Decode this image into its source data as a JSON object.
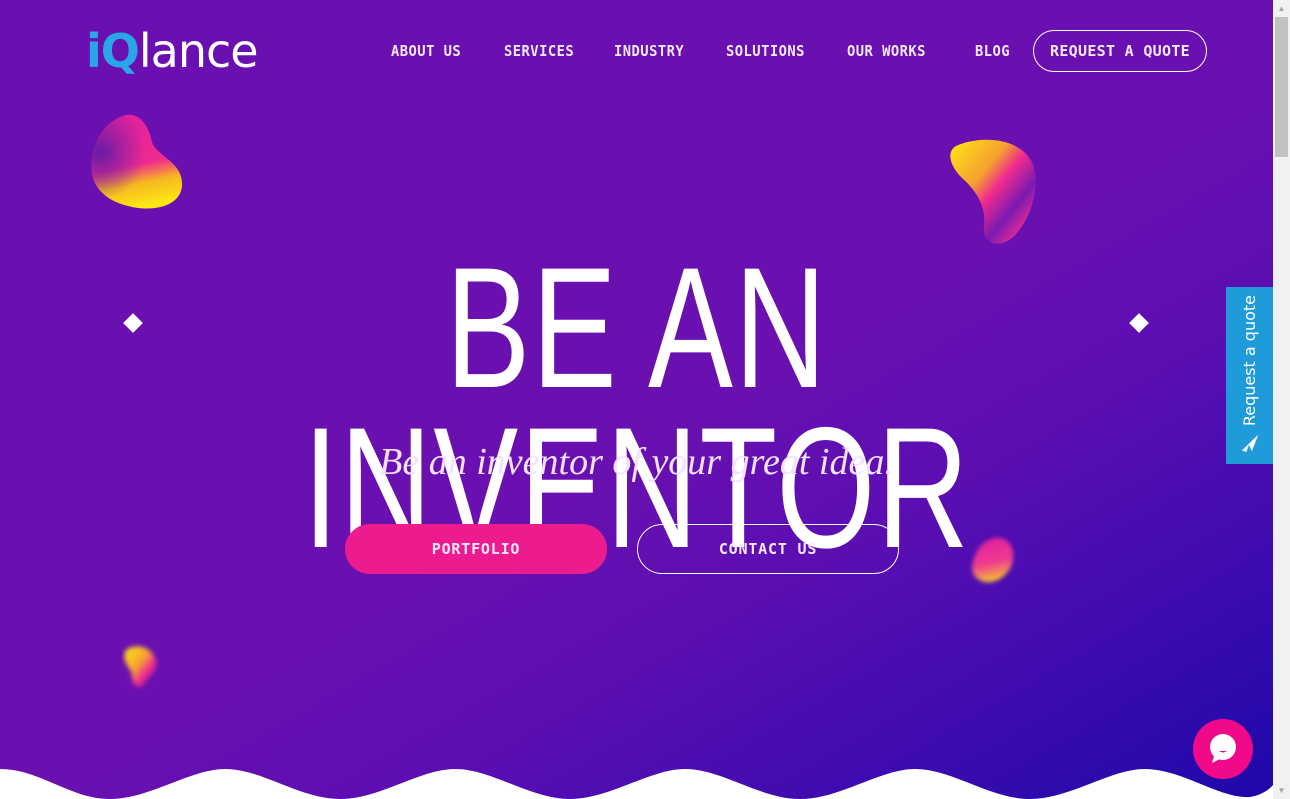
{
  "brand": {
    "logo_part1": "iQ",
    "logo_part2": "lance",
    "accent_color": "#2aa6e8"
  },
  "nav": {
    "items": [
      {
        "label": "ABOUT US"
      },
      {
        "label": "SERVICES"
      },
      {
        "label": "INDUSTRY"
      },
      {
        "label": "SOLUTIONS"
      },
      {
        "label": "OUR WORKS"
      },
      {
        "label": "BLOG"
      }
    ],
    "cta_label": "REQUEST A QUOTE"
  },
  "hero": {
    "headline": "BE AN INVENTOR",
    "tagline": "Be an inventor of your great idea.",
    "buttons": {
      "portfolio_label": "PORTFOLIO",
      "contact_label": "CONTACT US"
    },
    "colors": {
      "background_start": "#6a10b0",
      "background_end": "#1e08a8",
      "primary_button": "#ec1c8e"
    }
  },
  "side_widget": {
    "label": "Request a quote",
    "icon": "paper-plane-icon",
    "color": "#1f9bd9"
  },
  "chat_widget": {
    "icon": "chat-bubble-icon",
    "color": "#f00a8a"
  }
}
